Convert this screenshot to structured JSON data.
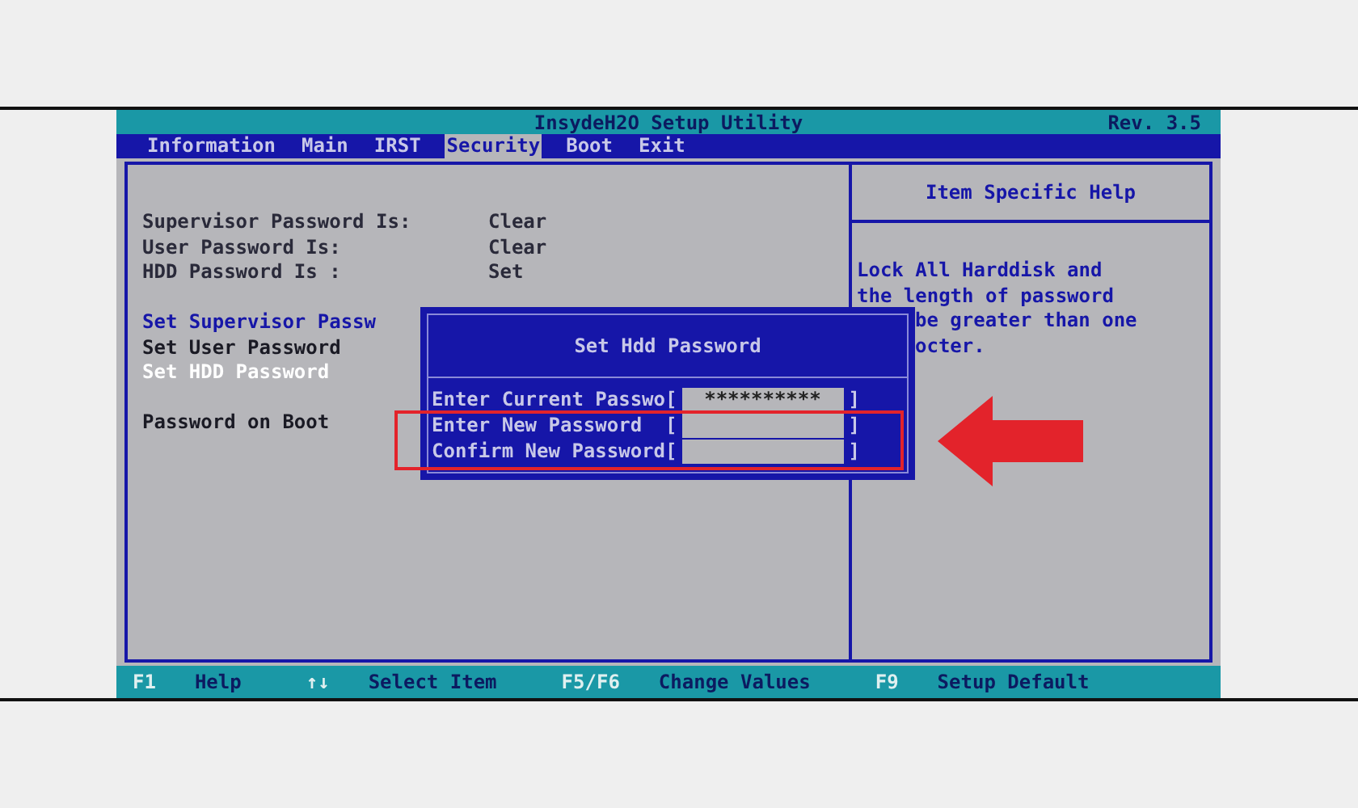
{
  "title_bar": {
    "title": "InsydeH2O Setup Utility",
    "revision": "Rev. 3.5"
  },
  "tabs": [
    {
      "label": "Information",
      "selected": false
    },
    {
      "label": "Main",
      "selected": false
    },
    {
      "label": "IRST",
      "selected": false
    },
    {
      "label": "Security",
      "selected": true
    },
    {
      "label": "Boot",
      "selected": false
    },
    {
      "label": "Exit",
      "selected": false
    }
  ],
  "status": [
    {
      "label": "Supervisor Password Is:",
      "value": "Clear"
    },
    {
      "label": "User Password Is:",
      "value": "Clear"
    },
    {
      "label": "HDD Password Is :",
      "value": "Set"
    }
  ],
  "items": [
    {
      "label": "Set Supervisor Passw",
      "selected": false,
      "disabled": false
    },
    {
      "label": "Set User Password",
      "selected": false,
      "disabled": true
    },
    {
      "label": "Set HDD Password",
      "selected": true,
      "disabled": false
    }
  ],
  "boot_item": {
    "label": "Password on Boot"
  },
  "help": {
    "title": "Item Specific Help",
    "lines": [
      "Lock All Harddisk and",
      "the length of password",
      "be greater than one",
      "octer."
    ]
  },
  "dialog": {
    "title": "Set Hdd Password",
    "rows": [
      {
        "label": "Enter Current Passwo[",
        "value": "**********",
        "close": "]"
      },
      {
        "label": "Enter New Password  [",
        "value": "",
        "close": "]"
      },
      {
        "label": "Confirm New Password[",
        "value": "",
        "close": "]"
      }
    ]
  },
  "annotations": [
    {
      "kind": "box"
    },
    {
      "kind": "arrow"
    }
  ],
  "key_bar": [
    {
      "key": "F1",
      "action": "Help"
    },
    {
      "key": "↑↓",
      "action": "Select Item"
    },
    {
      "key": "F5/F6",
      "action": "Change Values"
    },
    {
      "key": "F9",
      "action": "Setup Default"
    }
  ]
}
